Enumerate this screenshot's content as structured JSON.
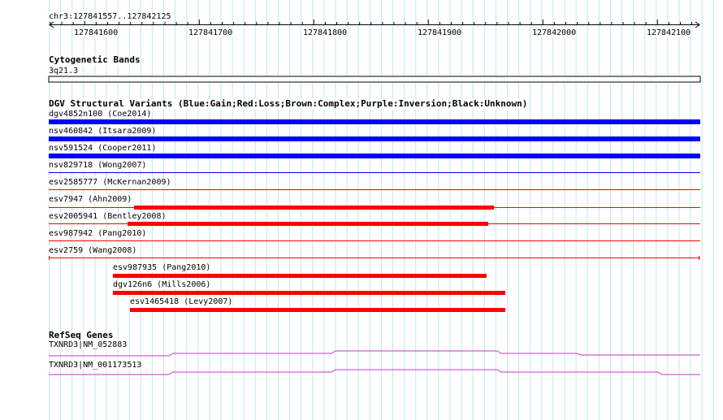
{
  "ruler": {
    "region": "chr3:127841557..127842125",
    "ticks": [
      "127841600",
      "127841700",
      "127841800",
      "127841900",
      "127842000",
      "127842100"
    ]
  },
  "cyto": {
    "title": "Cytogenetic Bands",
    "band": "3q21.3"
  },
  "dgv": {
    "title": "DGV Structural Variants (Blue:Gain;Red:Loss;Brown:Complex;Purple:Inversion;Black:Unknown)",
    "colors": {
      "gain": "#0000ff",
      "loss": "#ff0000"
    },
    "features": [
      {
        "label": "dgv4852n100 (Coe2014)",
        "type": "gain"
      },
      {
        "label": "nsv460842 (Itsara2009)",
        "type": "gain"
      },
      {
        "label": "nsv591524 (Cooper2011)",
        "type": "gain"
      },
      {
        "label": "nsv829718 (Wong2007)",
        "type": "gain"
      },
      {
        "label": "esv2585777 (McKernan2009)",
        "type": "loss"
      },
      {
        "label": "esv7947 (Ahn2009)",
        "type": "loss"
      },
      {
        "label": "esv2005941 (Bentley2008)",
        "type": "loss"
      },
      {
        "label": "esv987942 (Pang2010)",
        "type": "loss"
      },
      {
        "label": "esv2759 (Wang2008)",
        "type": "loss"
      },
      {
        "label": "esv987935 (Pang2010)",
        "type": "loss"
      },
      {
        "label": "dgv126n6 (Mills2006)",
        "type": "loss"
      },
      {
        "label": "esv1465418 (Levy2007)",
        "type": "loss"
      }
    ]
  },
  "refseq": {
    "title": "RefSeq Genes",
    "color": "#cc33cc",
    "transcripts": [
      {
        "label": "TXNRD3|NM_052883"
      },
      {
        "label": "TXNRD3|NM_001173513"
      }
    ]
  }
}
